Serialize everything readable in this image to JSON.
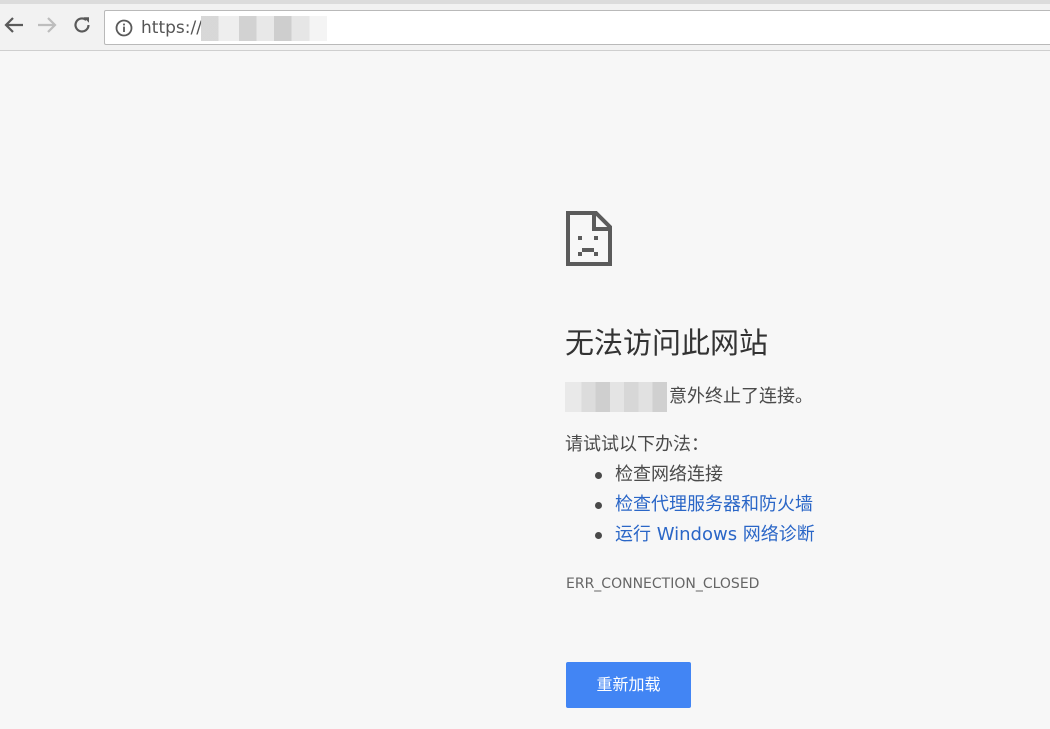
{
  "browser": {
    "url_scheme": "https://",
    "icons": {
      "back": "arrow-left-icon",
      "forward": "arrow-right-icon",
      "reload": "reload-icon",
      "site_info": "info-icon"
    }
  },
  "error_page": {
    "icon": "sad-document-icon",
    "title": "无法访问此网站",
    "summary": "意外终止了连接。",
    "suggest_intro": "请试试以下办法：",
    "suggestions": [
      {
        "label": "检查网络连接",
        "is_link": false
      },
      {
        "label": "检查代理服务器和防火墙",
        "is_link": true
      },
      {
        "label": "运行 Windows 网络诊断",
        "is_link": true
      }
    ],
    "error_code": "ERR_CONNECTION_CLOSED",
    "reload_label": "重新加载"
  },
  "colors": {
    "page_bg": "#f7f7f7",
    "link": "#2a66c7",
    "button": "#4285f4"
  }
}
